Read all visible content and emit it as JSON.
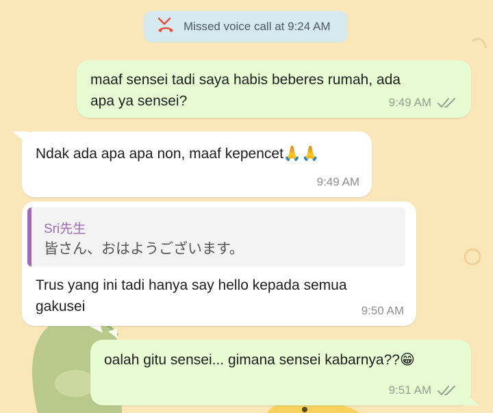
{
  "system_notice": {
    "icon": "missed-call-icon",
    "text": "Missed voice call at 9:24 AM",
    "color": "#e74c3c"
  },
  "messages": [
    {
      "direction": "outgoing",
      "text": "maaf sensei tadi saya habis beberes rumah, ada\napa ya sensei?",
      "time": "9:49 AM",
      "status": "read"
    },
    {
      "direction": "incoming",
      "text": "Ndak ada apa apa non, maaf kepencet🙏🙏",
      "time": "9:49 AM"
    },
    {
      "direction": "incoming",
      "reply": {
        "name": "Sri先生",
        "text": "皆さん、おはようございます。"
      },
      "text": "Trus yang ini tadi hanya say hello kepada semua\ngakusei",
      "time": "9:50 AM"
    },
    {
      "direction": "outgoing",
      "text": "oalah gitu sensei... gimana sensei kabarnya??😁",
      "time": "9:51 AM",
      "status": "read"
    }
  ],
  "colors": {
    "wallpaper": "#f9e7b9",
    "outgoing_bubble": "#e8fcd4",
    "incoming_bubble": "#ffffff",
    "reply_accent": "#9d6bb0",
    "read_ticks": "#8ea38e"
  }
}
